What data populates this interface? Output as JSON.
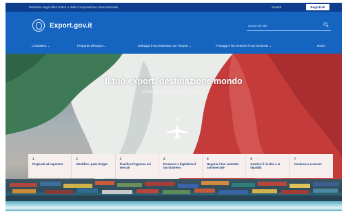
{
  "topbar": {
    "ministry": "Ministero degli Affari Esteri e della Cooperazione Internazionale",
    "login": "Accedi",
    "register": "Registrati"
  },
  "header": {
    "brand": "Export.gov.it",
    "search_placeholder": "Cerca nel sito",
    "icons": {
      "logo": "italian-republic-emblem",
      "search": "search-icon"
    }
  },
  "nav": {
    "items": [
      {
        "label": "L'iniziativa ⌄"
      },
      {
        "label": "Preparati all'export ⌄"
      },
      {
        "label": "Sviluppa il tuo business con l'export ⌄"
      },
      {
        "label": "Proteggi e fai crescere il tuo business ⌄"
      },
      {
        "label": "News"
      }
    ]
  },
  "hero": {
    "title": "Il tuo export, destinazione mondo",
    "subtitle": "Inizia tra il tuo viaggio in 7 passi"
  },
  "steps": [
    {
      "num": "1",
      "label": "Preparati ad esportare"
    },
    {
      "num": "2",
      "label": "Identifica i paesi target"
    },
    {
      "num": "3",
      "label": "Pianifica l'ingresso nei mercati"
    },
    {
      "num": "4",
      "label": "Promuovi e digitalizza il tuo business"
    },
    {
      "num": "5",
      "label": "Negozia il tuo contratto commerciale"
    },
    {
      "num": "6",
      "label": "Gestisci il rischio e la liquidità"
    },
    {
      "num": "7",
      "label": "Continua a crescere"
    }
  ],
  "colors": {
    "topbar": "#0d3d8c",
    "header": "#1565c0",
    "flag_green": "#3f7a57",
    "flag_white": "#e9ece9",
    "flag_red": "#c43b3a",
    "steps_bg": "#f6efee"
  }
}
